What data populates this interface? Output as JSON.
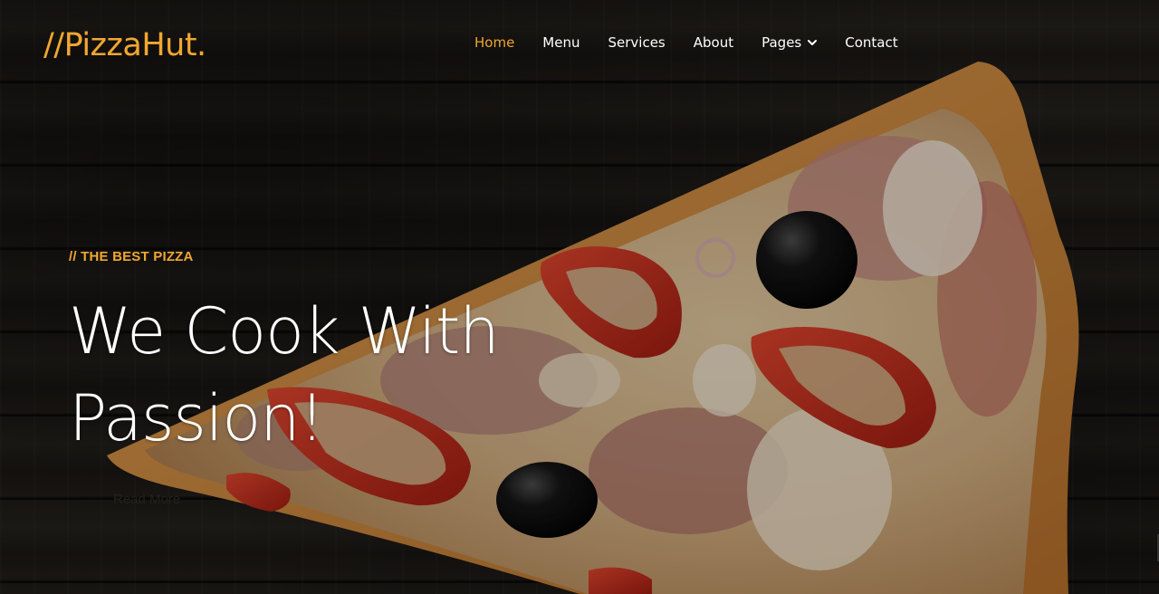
{
  "brand": {
    "logo_text": "//PizzaHut.",
    "accent_color": "#f0a730"
  },
  "nav": {
    "items": [
      {
        "label": "Home",
        "active": true
      },
      {
        "label": "Menu",
        "active": false
      },
      {
        "label": "Services",
        "active": false
      },
      {
        "label": "About",
        "active": false
      },
      {
        "label": "Pages",
        "active": false,
        "dropdown": true
      },
      {
        "label": "Contact",
        "active": false
      }
    ],
    "dropdown_icon": "chevron-down-icon"
  },
  "hero": {
    "eyebrow": "// THE BEST PIZZA",
    "headline_line1": "We Cook With",
    "headline_line2": "Passion!",
    "cta_label": "Read More",
    "background": "pizza slice on dark wooden table"
  }
}
